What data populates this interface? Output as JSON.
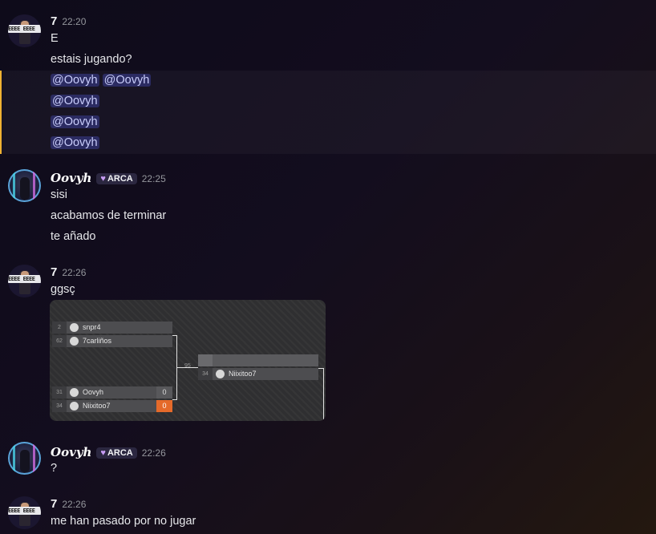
{
  "messages": [
    {
      "author": "7",
      "time": "22:20",
      "lines": [
        "E",
        "estais jugando?"
      ]
    },
    {
      "mentions": [
        [
          "@Oovyh",
          "@Oovyh"
        ],
        [
          "@Oovyh"
        ],
        [
          "@Oovyh"
        ],
        [
          "@Oovyh"
        ]
      ]
    },
    {
      "author": "Oovyh",
      "tag": "ARCA",
      "time": "22:25",
      "lines": [
        "sisi",
        "acabamos de terminar",
        "te añado"
      ]
    },
    {
      "author": "7",
      "time": "22:26",
      "lines": [
        "ggsç"
      ]
    },
    {
      "author": "Oovyh",
      "tag": "ARCA",
      "time": "22:26",
      "lines": [
        "?"
      ]
    },
    {
      "author": "7",
      "time": "22:26",
      "lines": [
        "me han pasado por no jugar"
      ]
    }
  ],
  "avatar_7_band": "EEEE EEEE",
  "bracket": {
    "round1_top": [
      {
        "seed": "2",
        "name": "snpr4"
      },
      {
        "seed": "62",
        "name": "7carliños"
      }
    ],
    "round1_bottom": [
      {
        "seed": "31",
        "name": "Oovyh",
        "score": "0"
      },
      {
        "seed": "34",
        "name": "Niixitoo7",
        "score": "0"
      }
    ],
    "connector_label": "95",
    "round2": [
      {
        "seed": "",
        "name": ""
      },
      {
        "seed": "34",
        "name": "Niixitoo7"
      }
    ]
  },
  "colors": {
    "accent_orange": "#e56a2a",
    "mention_bg": "#5865f2",
    "highlight_bar": "#f0b232",
    "tag_heart": "#c79cf3"
  },
  "icons": {
    "tag": "purple-heart-icon",
    "player": "player-avatar-icon"
  }
}
